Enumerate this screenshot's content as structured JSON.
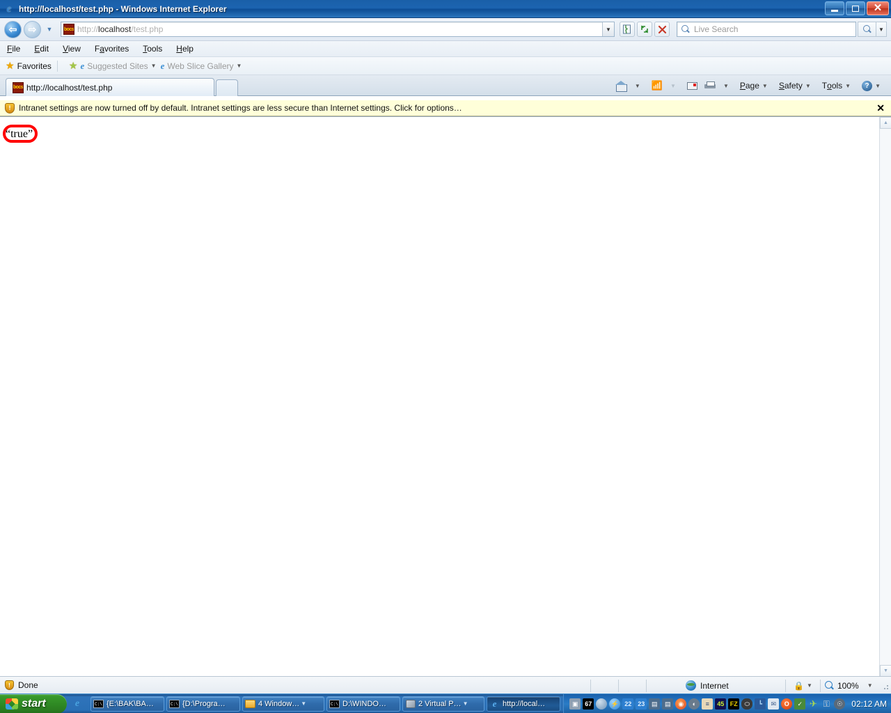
{
  "window": {
    "title": "http://localhost/test.php - Windows Internet Explorer",
    "app_icon": "ie-logo-icon",
    "minimize_label": "Minimize",
    "maximize_label": "Restore",
    "close_label": "Close"
  },
  "navbar": {
    "back_label": "Back",
    "forward_label": "Forward",
    "recent_pages_label": "Recent Pages",
    "address_protocol": "http://",
    "address_host": "localhost",
    "address_path": "/test.php",
    "address_full": "http://localhost/test.php",
    "favicon_text": "bocs",
    "compat_view_label": "Compatibility View",
    "refresh_label": "Refresh",
    "stop_label": "Stop",
    "search": {
      "placeholder": "Live Search",
      "value": "",
      "go_label": "Search",
      "dropdown_label": "Search Options"
    }
  },
  "menubar": {
    "items": [
      {
        "label": "File",
        "accel": "F"
      },
      {
        "label": "Edit",
        "accel": "E"
      },
      {
        "label": "View",
        "accel": "V"
      },
      {
        "label": "Favorites",
        "accel": "a"
      },
      {
        "label": "Tools",
        "accel": "T"
      },
      {
        "label": "Help",
        "accel": "H"
      }
    ]
  },
  "favorites_bar": {
    "favorites_label": "Favorites",
    "add_to_favorites_label": "Add to Favorites Bar",
    "items": [
      {
        "label": "Suggested Sites",
        "has_dropdown": true
      },
      {
        "label": "Web Slice Gallery",
        "has_dropdown": true
      }
    ]
  },
  "tabs": {
    "active": {
      "title": "http://localhost/test.php",
      "favicon_text": "bocs"
    },
    "new_tab_label": "New Tab"
  },
  "command_bar": {
    "home_label": "Home",
    "feeds_label": "Feeds",
    "read_mail_label": "Read Mail",
    "print_label": "Print",
    "items": [
      {
        "label": "Page",
        "accel": "P"
      },
      {
        "label": "Safety",
        "accel": "S"
      },
      {
        "label": "Tools",
        "accel": "o"
      }
    ],
    "help_label": "Help"
  },
  "info_bar": {
    "icon": "shield-warning-icon",
    "message": "Intranet settings are now turned off by default. Intranet settings are less secure than Internet settings. Click for options…",
    "close_label": "✕"
  },
  "content": {
    "page_text": "“true”",
    "annotation_color": "#ff0000",
    "annotation_shape": "rounded-rectangle"
  },
  "status_bar": {
    "status_text": "Done",
    "zone_label": "Internet",
    "zone_icon": "globe-icon",
    "protected_mode_icon": "lock-icon",
    "zoom_level": "100%",
    "zoom_icon": "zoom-magnifier-icon"
  },
  "taskbar": {
    "start_label": "start",
    "quick_launch": [
      {
        "name": "ie-quicklaunch-icon",
        "glyph": "e"
      }
    ],
    "tasks": [
      {
        "label": "{E:\\BAK\\BA…",
        "icon": "command-prompt-icon",
        "has_dropdown": false,
        "active": false
      },
      {
        "label": "{D:\\Progra…",
        "icon": "command-prompt-icon",
        "has_dropdown": false,
        "active": false
      },
      {
        "label": "4 Window…",
        "icon": "folder-icon",
        "has_dropdown": true,
        "active": false
      },
      {
        "label": "D:\\WINDO…",
        "icon": "command-prompt-icon",
        "has_dropdown": false,
        "active": false
      },
      {
        "label": "2 Virtual P…",
        "icon": "virtual-pc-icon",
        "has_dropdown": true,
        "active": false
      },
      {
        "label": "http://local…",
        "icon": "ie-logo-icon",
        "has_dropdown": false,
        "active": true
      }
    ],
    "tray_icons": [
      {
        "name": "virtual-machine-icon",
        "glyph": "▣",
        "bg": "#8fa0b2",
        "fg": "#ffffff"
      },
      {
        "name": "cpu-meter-icon",
        "glyph": "67",
        "bg": "#000000",
        "fg": "#ffffff"
      },
      {
        "name": "network-globe-icon",
        "glyph": "●",
        "bg": "#6f93b6",
        "fg": "#ffffff"
      },
      {
        "name": "power-icon",
        "glyph": "⚡",
        "bg": "#2f86d6",
        "fg": "#ffffff"
      },
      {
        "name": "monitor-22-icon",
        "glyph": "22",
        "bg": "#2d7fd0",
        "fg": "#cfe8ff"
      },
      {
        "name": "monitor-23-icon",
        "glyph": "23",
        "bg": "#2d7fd0",
        "fg": "#cfe8ff"
      },
      {
        "name": "network-connection-icon",
        "glyph": "⬚",
        "bg": "#4e6d8c",
        "fg": "#ffffff"
      },
      {
        "name": "network-connection-2-icon",
        "glyph": "⬚",
        "bg": "#4e6d8c",
        "fg": "#ffffff"
      },
      {
        "name": "firefox-icon",
        "glyph": "◕",
        "bg": "#d94b2a",
        "fg": "#ffffff"
      },
      {
        "name": "volume-icon",
        "glyph": "◐",
        "bg": "#6a7b8c",
        "fg": "#ffffff"
      },
      {
        "name": "messenger-icon",
        "glyph": "≣",
        "bg": "#e8d8b8",
        "fg": "#2a4a7a"
      },
      {
        "name": "counter-45-icon",
        "glyph": "45",
        "bg": "#11114f",
        "fg": "#c8f032"
      },
      {
        "name": "filezilla-icon",
        "glyph": "FZ",
        "bg": "#000000",
        "fg": "#e8d000"
      },
      {
        "name": "mouse-device-icon",
        "glyph": "⬭",
        "bg": "#3a3a3a",
        "fg": "#ffffff"
      },
      {
        "name": "grid-app-icon",
        "glyph": "⌗",
        "bg": "#2a5a9a",
        "fg": "#a8d0f0"
      },
      {
        "name": "mail-icon",
        "glyph": "✉",
        "bg": "#e0e8f0",
        "fg": "#3a5a8a"
      },
      {
        "name": "opera-icon",
        "glyph": "O",
        "bg": "#e04a10",
        "fg": "#ffffff"
      },
      {
        "name": "plug-icon",
        "glyph": "✓",
        "bg": "#4a8a3a",
        "fg": "#ffffff"
      },
      {
        "name": "airplane-icon",
        "glyph": "✈",
        "bg": "transparent",
        "fg": "#a8d850"
      },
      {
        "name": "key-icon",
        "glyph": "⚷",
        "bg": "transparent",
        "fg": "#d8d8d8"
      },
      {
        "name": "safeguard-icon",
        "glyph": "☉",
        "bg": "#5a6a7a",
        "fg": "#ffffff"
      }
    ],
    "clock": "02:12 AM"
  }
}
